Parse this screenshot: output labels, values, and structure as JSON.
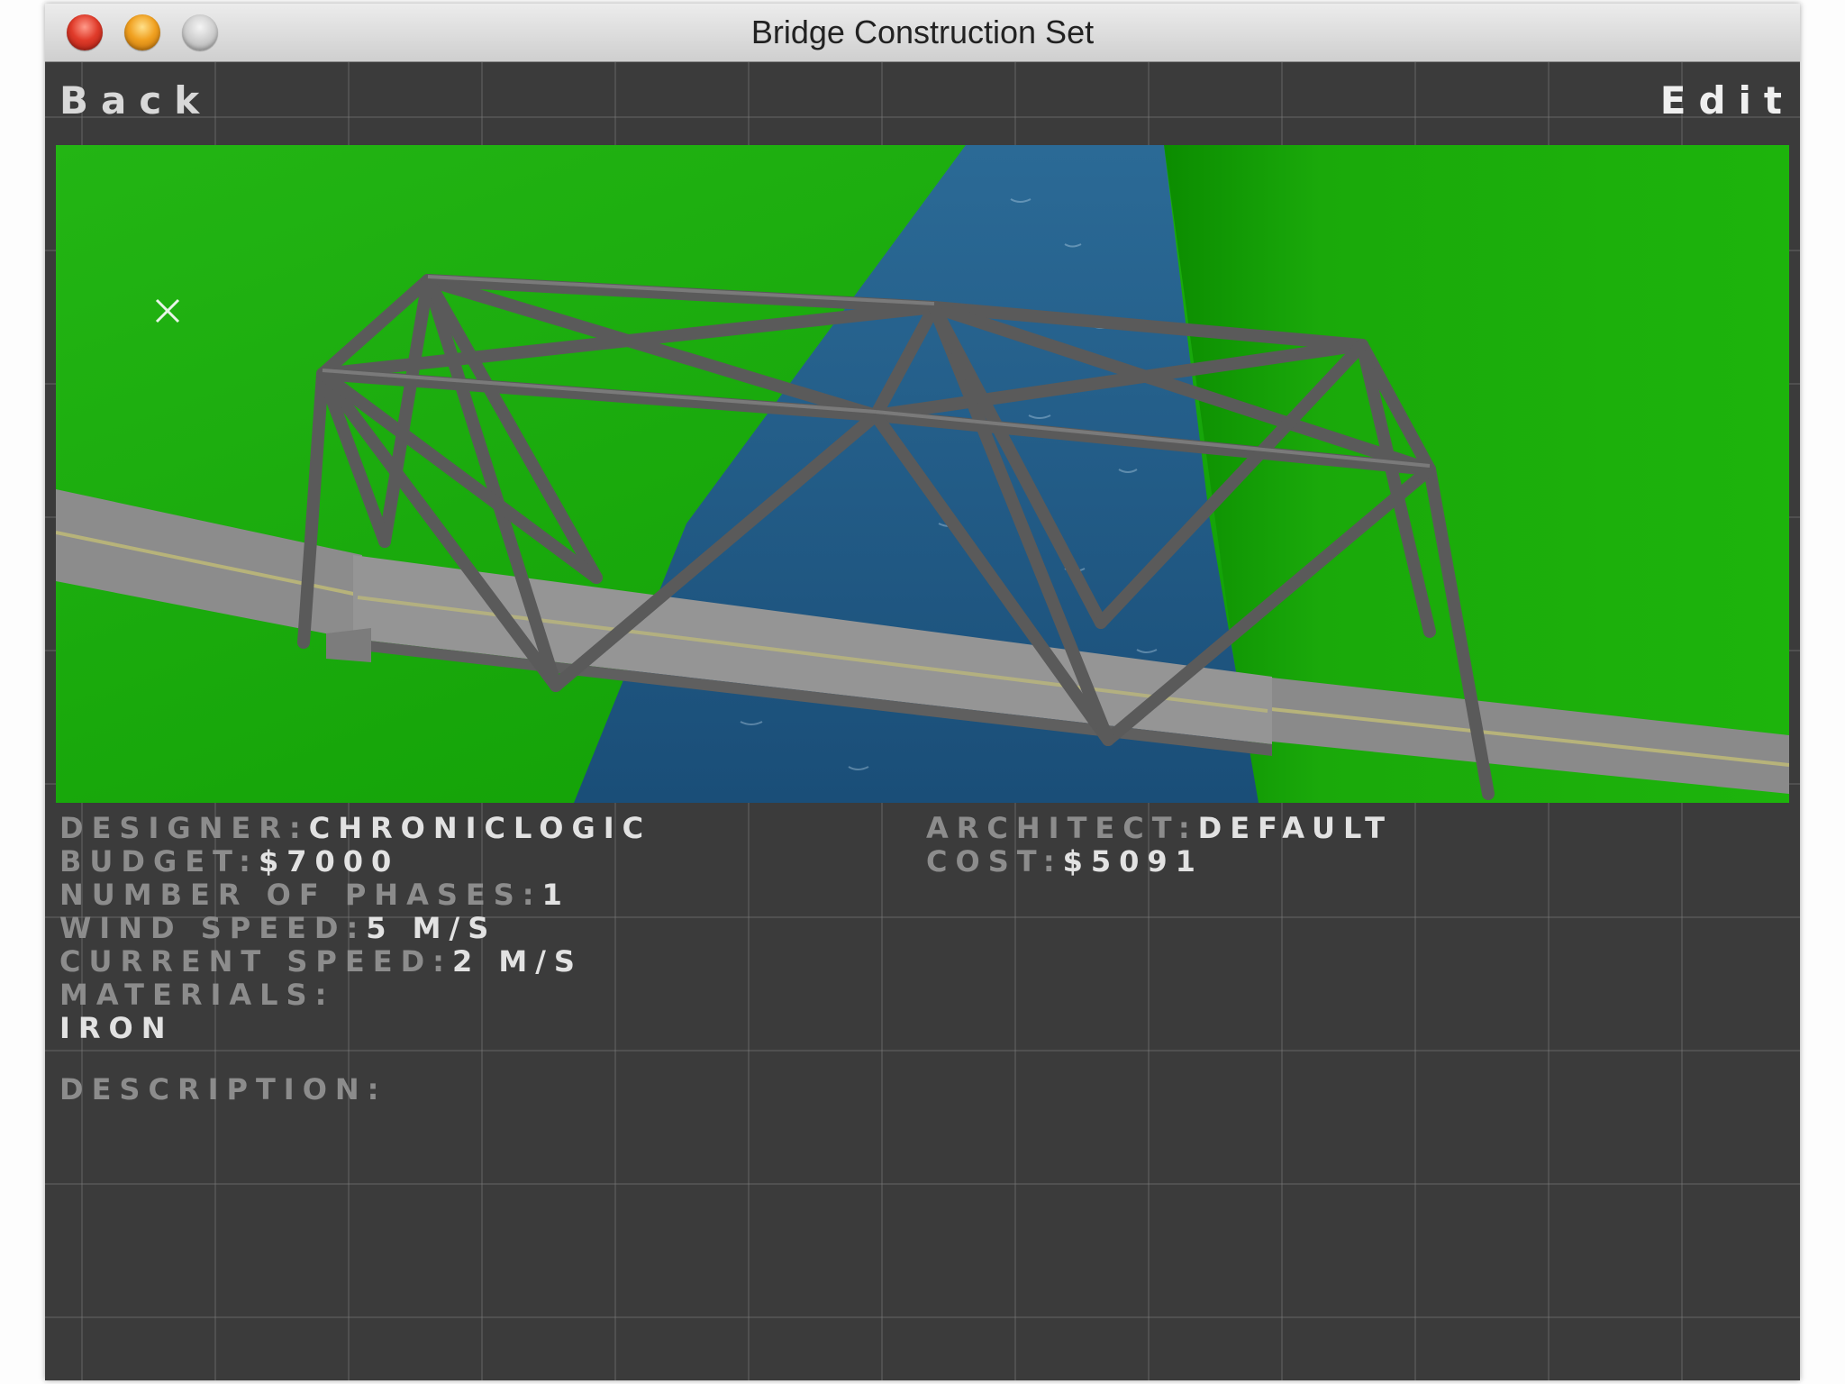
{
  "window": {
    "title": "Bridge Construction Set"
  },
  "nav": {
    "back_label": "Back",
    "edit_label": "Edit"
  },
  "viewport": {
    "grass_color": "#1aa90a",
    "water_color": "#1f5a86",
    "road_color": "#8a8a8a",
    "truss_color": "#565656",
    "cursor_icon": "crosshair-x-icon"
  },
  "info": {
    "designer_label": "Designer:",
    "designer_value": "Chroniclogic",
    "budget_label": "Budget:",
    "budget_value": "$7000",
    "phases_label": "Number of Phases:",
    "phases_value": "1",
    "wind_label": "Wind Speed:",
    "wind_value": "5 m/s",
    "current_label": "Current Speed:",
    "current_value": "2 m/s",
    "materials_label": "Materials:",
    "materials_value": "Iron",
    "architect_label": "Architect:",
    "architect_value": "Default",
    "cost_label": "Cost:",
    "cost_value": "$5091",
    "description_label": "Description:"
  }
}
